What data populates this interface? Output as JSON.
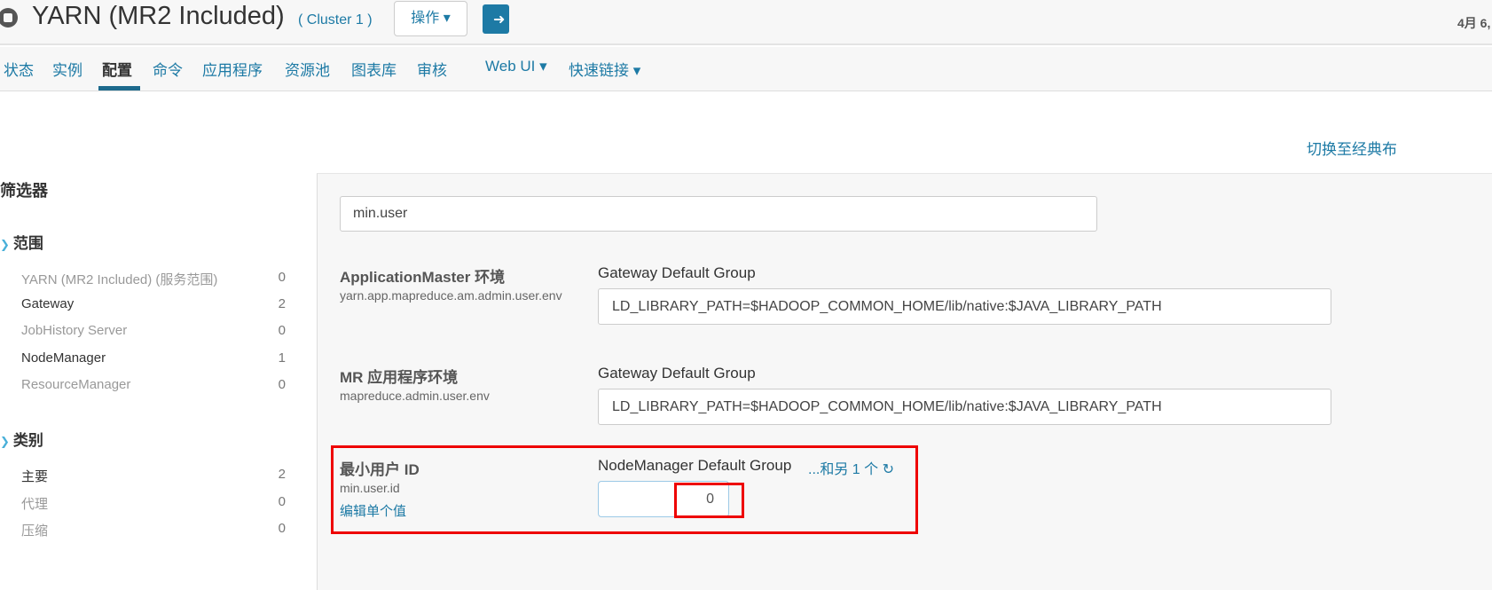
{
  "header": {
    "title": "YARN (MR2 Included)",
    "cluster": "( Cluster 1 )",
    "actions_label": "操作 ▾",
    "date": "4月 6,"
  },
  "nav": {
    "tabs": [
      "状态",
      "实例",
      "配置",
      "命令",
      "应用程序",
      "资源池",
      "图表库",
      "审核",
      "Web UI ▾",
      "快速链接 ▾"
    ],
    "active": "配置"
  },
  "switch_link": "切换至经典布",
  "filters": {
    "title": "筛选器",
    "scope": {
      "label": "范围",
      "items": [
        {
          "label": "YARN (MR2 Included) (服务范围)",
          "count": "0"
        },
        {
          "label": "Gateway",
          "count": "2"
        },
        {
          "label": "JobHistory Server",
          "count": "0"
        },
        {
          "label": "NodeManager",
          "count": "1"
        },
        {
          "label": "ResourceManager",
          "count": "0"
        }
      ]
    },
    "category": {
      "label": "类别",
      "items": [
        {
          "label": "主要",
          "count": "2"
        },
        {
          "label": "代理",
          "count": "0"
        },
        {
          "label": "压缩",
          "count": "0"
        }
      ]
    }
  },
  "search": {
    "value": "min.user"
  },
  "configs": [
    {
      "label": "ApplicationMaster 环境",
      "key": "yarn.app.mapreduce.am.admin.user.env",
      "group": "Gateway Default Group",
      "value": "LD_LIBRARY_PATH=$HADOOP_COMMON_HOME/lib/native:$JAVA_LIBRARY_PATH"
    },
    {
      "label": "MR 应用程序环境",
      "key": "mapreduce.admin.user.env",
      "group": "Gateway Default Group",
      "value": "LD_LIBRARY_PATH=$HADOOP_COMMON_HOME/lib/native:$JAVA_LIBRARY_PATH"
    },
    {
      "label": "最小用户 ID",
      "key": "min.user.id",
      "group": "NodeManager Default Group",
      "more": "...和另 1 个",
      "edit": "编辑单个值",
      "value": "0"
    }
  ],
  "colors": {
    "accent": "#1d7aa5",
    "highlight": "#e00000"
  }
}
